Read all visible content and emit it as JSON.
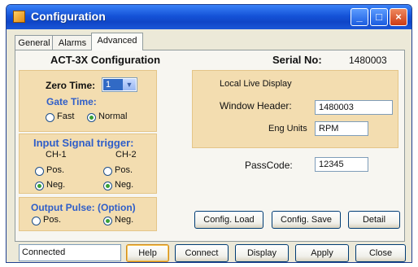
{
  "window": {
    "title": "Configuration",
    "controls": [
      "minimize-icon",
      "maximize-icon",
      "close-icon"
    ]
  },
  "tabs": [
    {
      "label": "General",
      "active": false
    },
    {
      "label": "Alarms",
      "active": false
    },
    {
      "label": "Advanced",
      "active": true
    }
  ],
  "header": {
    "device": "ACT-3X Configuration",
    "serial_label": "Serial No:",
    "serial_value": "1480003"
  },
  "left": {
    "zero_time_label": "Zero Time:",
    "zero_time_value": "1",
    "gate_time_label": "Gate Time:",
    "gate_time_options": [
      "Fast",
      "Normal"
    ],
    "gate_time_selected": "Normal",
    "input_signal": {
      "title": "Input Signal trigger:",
      "channels": [
        "CH-1",
        "CH-2"
      ],
      "ch1_options": [
        "Pos.",
        "Neg."
      ],
      "ch2_options": [
        "Pos.",
        "Neg."
      ],
      "ch1_selected": "Neg.",
      "ch2_selected": "Neg."
    },
    "output_pulse": {
      "title": "Output Pulse: (Option)",
      "options": [
        "Pos.",
        "Neg."
      ],
      "selected": "Neg."
    }
  },
  "right": {
    "local_live_display_label": "Local Live Display",
    "window_header_label": "Window Header:",
    "window_header_value": "1480003",
    "eng_units_label": "Eng Units",
    "eng_units_value": "RPM",
    "passcode_label": "PassCode:",
    "passcode_value": "12345"
  },
  "buttons": {
    "config_load": "Config. Load",
    "config_save": "Config. Save",
    "detail": "Detail",
    "help": "Help",
    "connect": "Connect",
    "display": "Display",
    "apply": "Apply",
    "close": "Close"
  },
  "status": "Connected",
  "colors": {
    "titlebar": "#0f45c7",
    "group_bg": "#f3ddb0",
    "accent_blue": "#2f5ec9",
    "radio_on": "#38a035"
  }
}
